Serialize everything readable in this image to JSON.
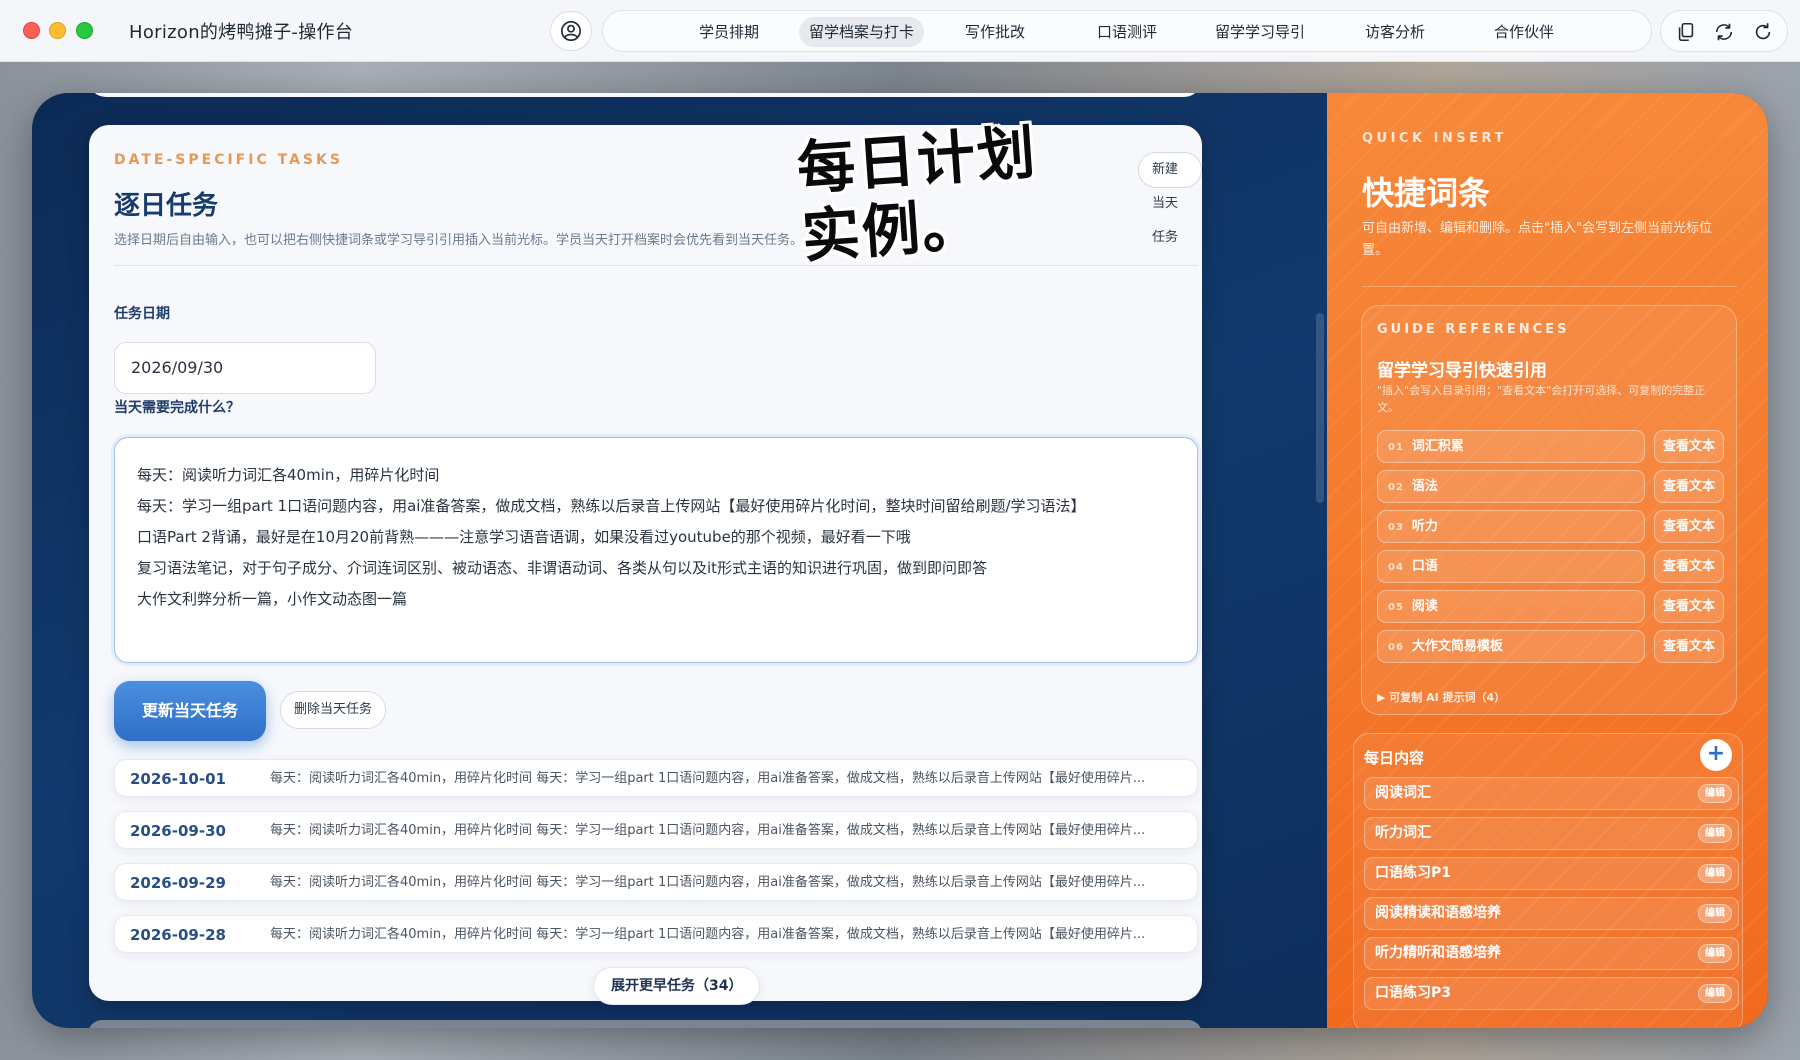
{
  "app": {
    "title": "Horizon的烤鸭摊子-操作台"
  },
  "nav": {
    "items": [
      {
        "label": "学员排期",
        "active": false
      },
      {
        "label": "留学档案与打卡",
        "active": true
      },
      {
        "label": "写作批改",
        "active": false
      },
      {
        "label": "口语测评",
        "active": false
      },
      {
        "label": "留学学习导引",
        "active": false
      },
      {
        "label": "访客分析",
        "active": false
      },
      {
        "label": "合作伙伴",
        "active": false
      }
    ]
  },
  "tools": {
    "icons": [
      "copy-icon",
      "refresh-icon",
      "reload-icon"
    ]
  },
  "tasks": {
    "eyebrow": "DATE-SPECIFIC TASKS",
    "title": "逐日任务",
    "description": "选择日期后自由输入，也可以把右侧快捷词条或学习导引引用插入当前光标。学员当天打开档案时会优先看到当天任务。",
    "new_button": "新建当天任务",
    "overlay_caption_line1": "每日计划",
    "overlay_caption_line2": "实例。",
    "date_label": "任务日期",
    "date_value": "2026/09/30",
    "content_label": "当天需要完成什么？",
    "content_lines": [
      "每天：阅读听力词汇各40min，用碎片化时间",
      "每天：学习一组part 1口语问题内容，用ai准备答案，做成文档，熟练以后录音上传网站【最好使用碎片化时间，整块时间留给刷题/学习语法】",
      "口语Part 2背诵，最好是在10月20前背熟———注意学习语音语调，如果没看过youtube的那个视频，最好看一下哦",
      "复习语法笔记，对于句子成分、介词连词区别、被动语态、非谓语动词、各类从句以及it形式主语的知识进行巩固，做到即问即答",
      "大作文利弊分析一篇，小作文动态图一篇"
    ],
    "update_button": "更新当天任务",
    "delete_button": "删除当天任务",
    "list": [
      {
        "date": "2026-10-01",
        "summary": "每天：阅读听力词汇各40min，用碎片化时间 每天：学习一组part 1口语问题内容，用ai准备答案，做成文档，熟练以后录音上传网站【最好使用碎片..."
      },
      {
        "date": "2026-09-30",
        "summary": "每天：阅读听力词汇各40min，用碎片化时间 每天：学习一组part 1口语问题内容，用ai准备答案，做成文档，熟练以后录音上传网站【最好使用碎片..."
      },
      {
        "date": "2026-09-29",
        "summary": "每天：阅读听力词汇各40min，用碎片化时间 每天：学习一组part 1口语问题内容，用ai准备答案，做成文档，熟练以后录音上传网站【最好使用碎片..."
      },
      {
        "date": "2026-09-28",
        "summary": "每天：阅读听力词汇各40min，用碎片化时间 每天：学习一组part 1口语问题内容，用ai准备答案，做成文档，熟练以后录音上传网站【最好使用碎片..."
      }
    ],
    "more_button": "展开更早任务（34）"
  },
  "quick_insert": {
    "eyebrow": "QUICK INSERT",
    "title": "快捷词条",
    "description": "可自由新增、编辑和删除。点击\"插入\"会写到左侧当前光标位置。",
    "guide": {
      "eyebrow": "GUIDE REFERENCES",
      "title": "留学学习导引快速引用",
      "description": "\"插入\"会写入目录引用；\"查看文本\"会打开可选择、可复制的完整正文。",
      "items": [
        {
          "num": "01",
          "label": "词汇积累"
        },
        {
          "num": "02",
          "label": "语法"
        },
        {
          "num": "03",
          "label": "听力"
        },
        {
          "num": "04",
          "label": "口语"
        },
        {
          "num": "05",
          "label": "阅读"
        },
        {
          "num": "06",
          "label": "大作文简易模板"
        }
      ],
      "view_label": "查看文本",
      "ai_prompts": "▶ 可复制 AI 提示词（4）"
    },
    "daily": {
      "title": "每日内容",
      "add_label": "+",
      "edit_label": "编辑",
      "items": [
        "阅读词汇",
        "听力词汇",
        "口语练习P1",
        "阅读精读和语感培养",
        "听力精听和语感培养",
        "口语练习P3"
      ]
    }
  },
  "colors": {
    "accent_blue": "#2f6fc8",
    "accent_orange": "#f57a2c",
    "navy": "#0c2a55",
    "eyebrow_orange": "#e49a54"
  }
}
